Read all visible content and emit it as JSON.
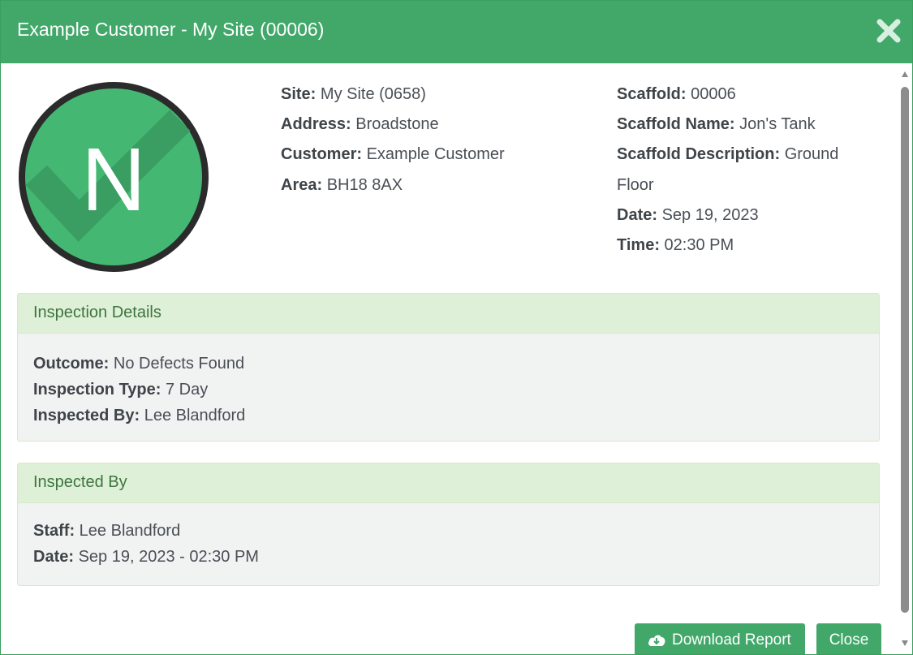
{
  "dialog": {
    "title": "Example Customer - My Site (00006)"
  },
  "badge": {
    "letter": "N",
    "color": "#44b872",
    "ring_color": "#2b2b2b"
  },
  "site_info": [
    {
      "label": "Site:",
      "value": "My Site (0658)"
    },
    {
      "label": "Address:",
      "value": "Broadstone"
    },
    {
      "label": "Customer:",
      "value": "Example Customer"
    },
    {
      "label": "Area:",
      "value": "BH18 8AX"
    }
  ],
  "scaffold_info": [
    {
      "label": "Scaffold:",
      "value": "00006"
    },
    {
      "label": "Scaffold Name:",
      "value": "Jon's Tank"
    },
    {
      "label": "Scaffold Description:",
      "value": "Ground Floor"
    },
    {
      "label": "Date:",
      "value": "Sep 19, 2023"
    },
    {
      "label": "Time:",
      "value": "02:30 PM"
    }
  ],
  "inspection_details": {
    "heading": "Inspection Details",
    "rows": [
      {
        "label": "Outcome:",
        "value": "No Defects Found"
      },
      {
        "label": "Inspection Type:",
        "value": "7 Day"
      },
      {
        "label": "Inspected By:",
        "value": "Lee Blandford"
      }
    ]
  },
  "inspected_by": {
    "heading": "Inspected By",
    "rows": [
      {
        "label": "Staff:",
        "value": "Lee Blandford"
      },
      {
        "label": "Date:",
        "value": "Sep 19, 2023 - 02:30 PM"
      }
    ]
  },
  "footer": {
    "download_label": "Download Report",
    "close_label": "Close",
    "download_icon": "cloud-download-icon"
  },
  "colors": {
    "header": "#41a869",
    "panel_heading": "#dff0d8",
    "panel_heading_text": "#3c763d"
  }
}
